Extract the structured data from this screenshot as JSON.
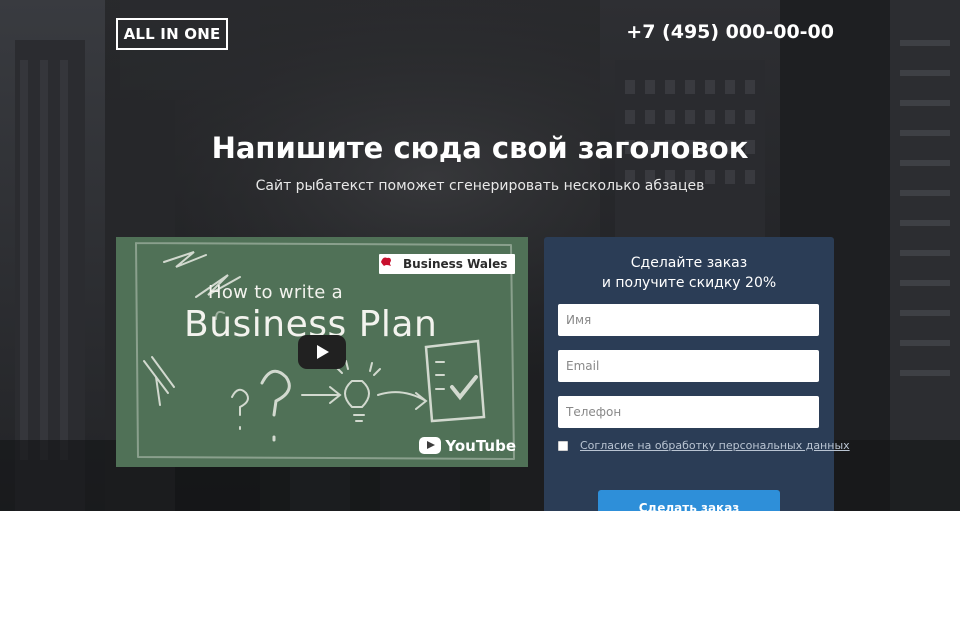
{
  "header": {
    "logo_text": "ALL IN ONE",
    "phone": "+7 (495) 000-00-00"
  },
  "hero": {
    "title": "Напишите сюда свой заголовок",
    "subtitle": "Сайт рыбатекст поможет сгенерировать несколько абзацев"
  },
  "video": {
    "badge_text": "Business Wales",
    "title_line1": "How to write a",
    "title_line2": "Business Plan",
    "player_brand": "YouTube"
  },
  "form": {
    "title_line1": "Сделайте заказ",
    "title_line2": "и получите скидку 20%",
    "name_placeholder": "Имя",
    "email_placeholder": "Email",
    "phone_placeholder": "Телефон",
    "consent_label": "Согласие на обработку персональных данных",
    "consent_checked": false,
    "submit_label": "Сделать заказ"
  },
  "colors": {
    "form_background": "#2b3d56",
    "button": "#2e8fd9",
    "chalkboard": "#4a6b52"
  },
  "icons": {
    "video_play": "play-icon",
    "youtube": "youtube-icon",
    "badge": "business-wales-icon"
  }
}
